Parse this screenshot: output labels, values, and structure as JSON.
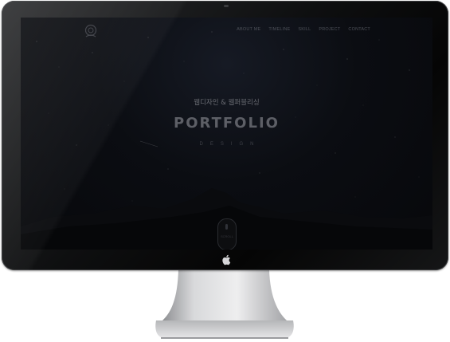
{
  "nav": {
    "items": [
      {
        "label": "ABOUT ME"
      },
      {
        "label": "TIMELINE"
      },
      {
        "label": "SKILL"
      },
      {
        "label": "PROJECT"
      },
      {
        "label": "CONTACT"
      }
    ]
  },
  "hero": {
    "subtitle": "웹디자인 & 웹퍼블리싱",
    "title": "PORTFOLIO",
    "tagline": "DESIGN"
  },
  "scroll": {
    "label": "SCROLL"
  },
  "colors": {
    "bezel": "#0e0f10",
    "screen_bg": "#0b0d12",
    "text_muted": "#5d5f66",
    "stand_silver": "#c9cacc"
  },
  "icons": {
    "logo": "astronaut-logo-icon",
    "scroll": "scroll-mouse-icon",
    "brand": "apple-logo-icon"
  }
}
